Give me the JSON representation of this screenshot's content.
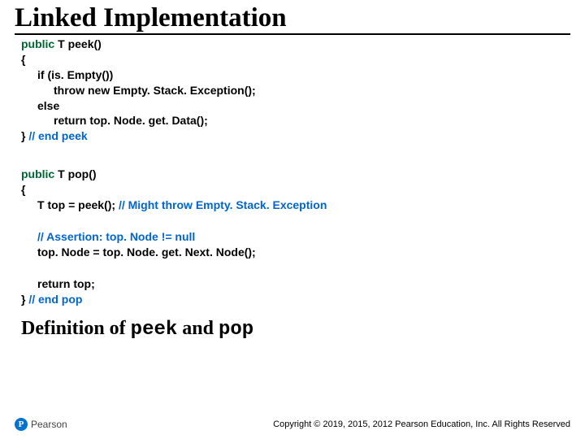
{
  "title": "Linked Implementation",
  "code1": {
    "l1a": "public",
    "l1b": " T peek()",
    "l2": "{",
    "l3a": "if",
    "l3b": " (is. Empty())",
    "l4a": "throw new",
    "l4b": " Empty. Stack. Exception();",
    "l5": "else",
    "l6a": "return",
    "l6b": " top. Node. get. Data();",
    "l7a": "} ",
    "l7b": "// end peek"
  },
  "code2": {
    "l1a": "public",
    "l1b": " T pop()",
    "l2": "{",
    "l3a": "T top = peek();  ",
    "l3b": "// Might throw Empty. Stack. Exception",
    "l4": "// Assertion: top. Node != null",
    "l5": "top. Node = top. Node. get. Next. Node();",
    "l6a": "return",
    "l6b": " top;",
    "l7a": "} ",
    "l7b": "// end pop"
  },
  "subtitle": {
    "pre": "Definition of ",
    "m1": "peek",
    "mid": " and ",
    "m2": "pop"
  },
  "logo": {
    "letter": "P",
    "name": "Pearson"
  },
  "copyright": "Copyright © 2019, 2015, 2012 Pearson Education, Inc. All Rights Reserved"
}
